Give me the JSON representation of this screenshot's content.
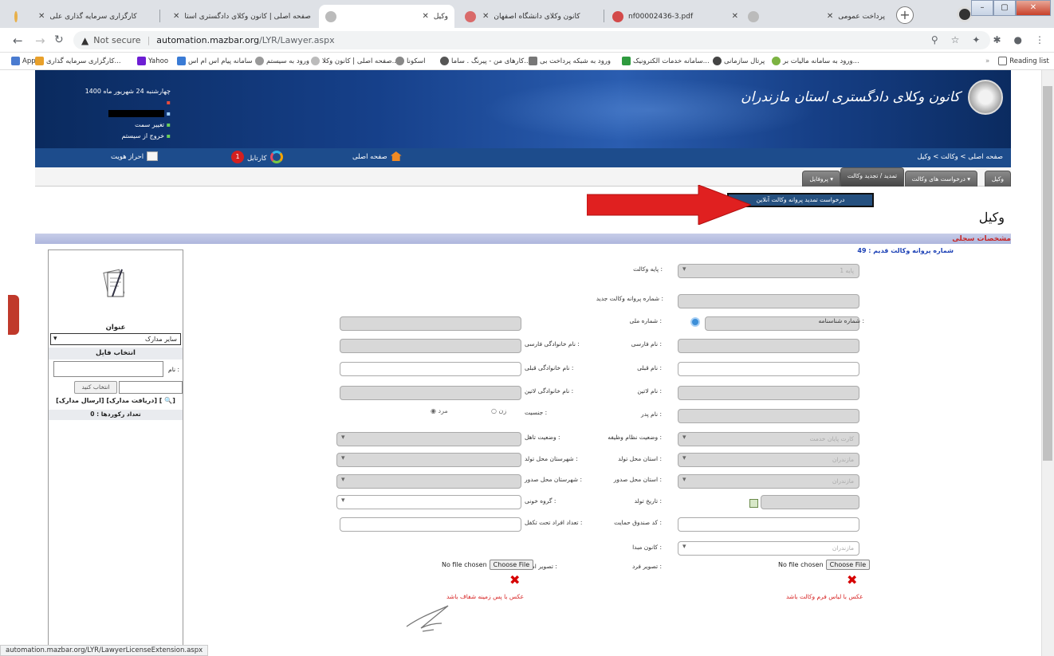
{
  "browser": {
    "tabs": [
      {
        "title": "کارگزاری سرمایه گذاری علی",
        "active": false
      },
      {
        "title": "صفحه اصلی | کانون وکلای دادگستری استا",
        "active": false
      },
      {
        "title": "وکیل",
        "active": true
      },
      {
        "title": "کانون وکلای دانشگاه اصفهان",
        "active": false
      },
      {
        "title": "nf00002436-3.pdf",
        "active": false
      },
      {
        "title": "پرداخت عمومی",
        "active": false
      }
    ],
    "url_warning": "Not secure",
    "url_host": "automation.mazbar.org",
    "url_path": "/LYR/Lawyer.aspx",
    "bookmarks": [
      "Apps",
      "کارگزاری سرمایه گذاری...",
      "Yahoo",
      "سامانه پیام اس ام اس",
      "ورود به سیستم",
      "صفحه اصلی | کانون وکلا...",
      "اسکونا",
      "کارهای من - پیرنگ . ساما...",
      "ورود به شبکه پرداخت بی",
      "سامانه خدمات الکترونیک...",
      "پرتال سازمانی",
      "ورود به سامانه مالیات بر..."
    ],
    "reading_list": "Reading list",
    "status_url": "automation.mazbar.org/LYR/LawyerLicenseExtension.aspx"
  },
  "header": {
    "date": "چهارشنبه 24 شهریور ماه 1400",
    "change_role": "تغییر سمت",
    "logout": "خروج از سیستم",
    "org_name": "کانون وکلای دادگستری استان مازندران"
  },
  "navbar": {
    "breadcrumb": "صفحه اصلی > وکالت > وکیل",
    "home": "صفحه اصلی",
    "cartable": "کارتابل",
    "cartable_count": "1",
    "identity": "احراز هویت"
  },
  "submenu": {
    "tabs": [
      "وکیل",
      "درخواست های وکالت ▾",
      "تمدید / تجدید وکالت",
      "پروفایل ▾"
    ],
    "dropdown_item": "درخواست تمدید پروانه وکالت آنلاین"
  },
  "page": {
    "title": "وکیل",
    "section": "مشخصات سجلی",
    "old_license": "شماره پروانه وکالت قدیم : 49"
  },
  "form": {
    "grade_label": "پایه وکالت :",
    "grade_value": "پایه 1",
    "new_license_label": "شماره پروانه وکالت جدید :",
    "national_id_label": "شماره ملی :",
    "id_number_label": "شماره شناسنامه :",
    "first_name_fa_label": "نام فارسی :",
    "last_name_fa_label": "نام خانوادگی فارسی :",
    "prev_first_name_label": "نام قبلی :",
    "prev_last_name_label": "نام خانوادگی قبلی :",
    "first_name_en_label": "نام لاتین :",
    "last_name_en_label": "نام خانوادگی لاتین :",
    "father_name_label": "نام پدر :",
    "gender_label": "جنسیت :",
    "gender_female": "زن",
    "gender_male": "مرد",
    "military_label": "وضعیت نظام وظیفه :",
    "military_value": "کارت پایان خدمت",
    "marital_label": "وضعیت تاهل :",
    "birth_province_label": "استان محل تولد :",
    "birth_province_value": "مازندران",
    "birth_city_label": "شهرستان محل تولد :",
    "issue_province_label": "استان محل صدور :",
    "issue_province_value": "مازندران",
    "issue_city_label": "شهرستان محل صدور :",
    "birth_date_label": "تاریخ تولد :",
    "blood_label": "گروه خونی :",
    "fund_code_label": "کد صندوق حمایت :",
    "dependents_label": "تعداد افراد تحت تکفل :",
    "origin_bar_label": "کانون مبدا :",
    "origin_bar_value": "مازندران",
    "photo_label": "تصویر فرد :",
    "signature_label": "تصویر امضا :",
    "no_file": "No file chosen",
    "choose_file": "Choose File",
    "photo_note": "عکس با لباس فرم وکالت باشد",
    "signature_note": "عکس با پس زمینه شفاف باشد"
  },
  "sidepanel": {
    "title_label": "عنوان",
    "doc_type": "سایر مدارک",
    "choose_file_label": "انتخاب فایل",
    "name_label": "نام :",
    "choose_button": "انتخاب کنید",
    "links": "[ارسال مدارک] [دریافت مدارک] [",
    "records": "تعداد رکوردها : 0"
  },
  "colors": {
    "header_blue": "#16408a",
    "nav_blue": "#1d4c8c",
    "accent_red": "#d60000"
  }
}
